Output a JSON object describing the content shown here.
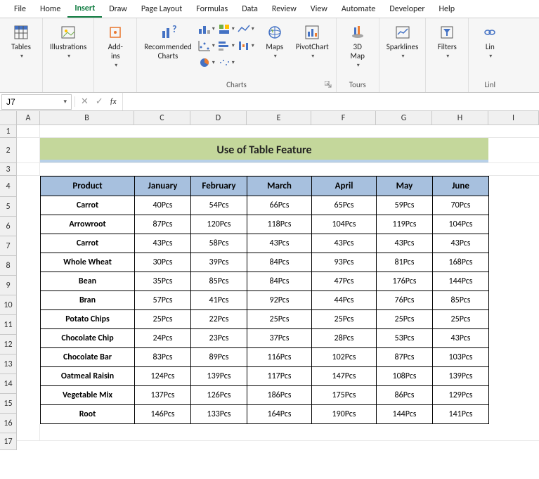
{
  "menubar": [
    "File",
    "Home",
    "Insert",
    "Draw",
    "Page Layout",
    "Formulas",
    "Data",
    "Review",
    "View",
    "Automate",
    "Developer",
    "Help"
  ],
  "active_menu": "Insert",
  "ribbon": {
    "tables_label": "Tables",
    "illustrations_label": "Illustrations",
    "addins_label": "Add-\nins",
    "recommended_label": "Recommended\nCharts",
    "charts_group": "Charts",
    "maps_label": "Maps",
    "pivotchart_label": "PivotChart",
    "3dmap_label": "3D\nMap",
    "tours_group": "Tours",
    "sparklines_label": "Sparklines",
    "filters_label": "Filters",
    "link_label": "Lin",
    "link_group": "Linl"
  },
  "name_box": "J7",
  "formula_value": "",
  "columns": [
    "A",
    "B",
    "C",
    "D",
    "E",
    "F",
    "G",
    "H",
    "I"
  ],
  "rows": [
    "1",
    "2",
    "3",
    "4",
    "5",
    "6",
    "7",
    "8",
    "9",
    "10",
    "11",
    "12",
    "13",
    "14",
    "15",
    "16",
    "17"
  ],
  "sheet_title": "Use of Table Feature",
  "table": {
    "headers": [
      "Product",
      "January",
      "February",
      "March",
      "April",
      "May",
      "June"
    ],
    "rows": [
      [
        "Carrot",
        "40Pcs",
        "54Pcs",
        "66Pcs",
        "65Pcs",
        "59Pcs",
        "70Pcs"
      ],
      [
        "Arrowroot",
        "87Pcs",
        "120Pcs",
        "118Pcs",
        "104Pcs",
        "119Pcs",
        "104Pcs"
      ],
      [
        "Carrot",
        "43Pcs",
        "58Pcs",
        "43Pcs",
        "43Pcs",
        "43Pcs",
        "43Pcs"
      ],
      [
        "Whole Wheat",
        "30Pcs",
        "39Pcs",
        "84Pcs",
        "93Pcs",
        "81Pcs",
        "168Pcs"
      ],
      [
        "Bean",
        "35Pcs",
        "85Pcs",
        "84Pcs",
        "47Pcs",
        "176Pcs",
        "144Pcs"
      ],
      [
        "Bran",
        "57Pcs",
        "41Pcs",
        "92Pcs",
        "44Pcs",
        "76Pcs",
        "85Pcs"
      ],
      [
        "Potato Chips",
        "25Pcs",
        "22Pcs",
        "25Pcs",
        "25Pcs",
        "25Pcs",
        "25Pcs"
      ],
      [
        "Chocolate Chip",
        "24Pcs",
        "23Pcs",
        "37Pcs",
        "28Pcs",
        "53Pcs",
        "43Pcs"
      ],
      [
        "Chocolate Bar",
        "83Pcs",
        "89Pcs",
        "116Pcs",
        "102Pcs",
        "87Pcs",
        "103Pcs"
      ],
      [
        "Oatmeal Raisin",
        "124Pcs",
        "139Pcs",
        "117Pcs",
        "147Pcs",
        "108Pcs",
        "139Pcs"
      ],
      [
        "Vegetable Mix",
        "137Pcs",
        "126Pcs",
        "186Pcs",
        "175Pcs",
        "86Pcs",
        "129Pcs"
      ],
      [
        "Root",
        "146Pcs",
        "133Pcs",
        "164Pcs",
        "190Pcs",
        "144Pcs",
        "141Pcs"
      ]
    ]
  }
}
